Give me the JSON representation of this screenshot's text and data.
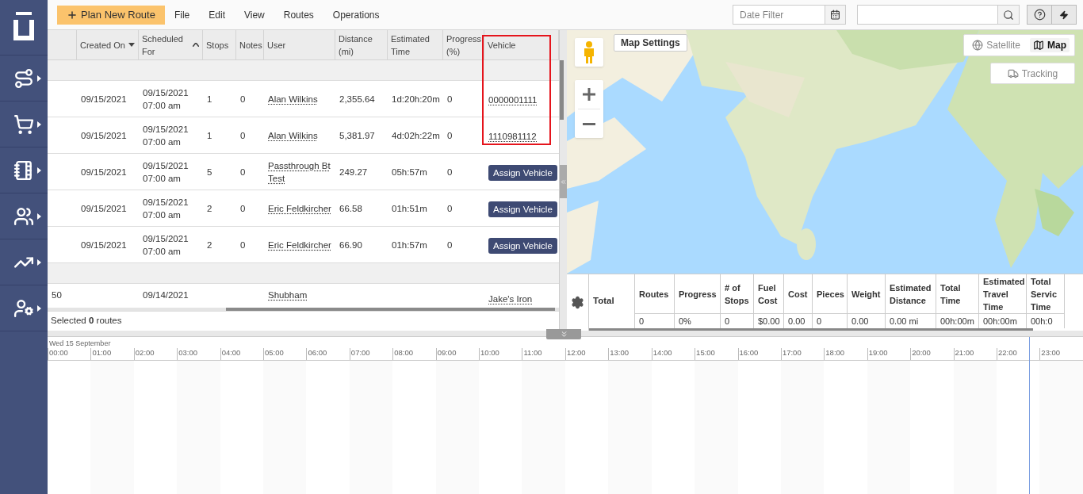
{
  "toolbar": {
    "primary_button": "Plan New Route",
    "menus": [
      "File",
      "Edit",
      "View",
      "Routes",
      "Operations"
    ],
    "date_filter": {
      "placeholder": "Date Filter"
    }
  },
  "routes_table": {
    "columns": [
      {
        "label": "Created On",
        "sorted": true,
        "descending": true
      },
      {
        "label": "Scheduled For",
        "sorted": true,
        "descending": false
      },
      {
        "label": "Stops",
        "sorted": false
      },
      {
        "label": "Notes",
        "sorted": false
      },
      {
        "label": "User",
        "sorted": false
      },
      {
        "label": "Distance (mi)",
        "sorted": false
      },
      {
        "label": "Estimated Time",
        "sorted": false
      },
      {
        "label": "Progress (%)",
        "sorted": false
      },
      {
        "label": "Vehicle",
        "sorted": false
      }
    ],
    "rows": [
      {
        "kind": "group"
      },
      {
        "kind": "route",
        "created": "09/15/2021",
        "scheduled_date": "09/15/2021",
        "scheduled_time": "07:00 am",
        "stops": "1",
        "notes": "0",
        "user": "Alan Wilkins",
        "distance": "2,355.64",
        "est_time": "1d:20h:20m",
        "progress": "0",
        "vehicle": {
          "kind": "link",
          "label": "0000001111"
        }
      },
      {
        "kind": "route",
        "created": "09/15/2021",
        "scheduled_date": "09/15/2021",
        "scheduled_time": "07:00 am",
        "stops": "1",
        "notes": "0",
        "user": "Alan Wilkins",
        "distance": "5,381.97",
        "est_time": "4d:02h:22m",
        "progress": "0",
        "vehicle": {
          "kind": "link",
          "label": "1110981112"
        }
      },
      {
        "kind": "route",
        "created": "09/15/2021",
        "scheduled_date": "09/15/2021",
        "scheduled_time": "07:00 am",
        "stops": "5",
        "notes": "0",
        "user": "Passthrough Bt Test",
        "distance": "249.27",
        "est_time": "05h:57m",
        "progress": "0",
        "vehicle": {
          "kind": "button",
          "label": "Assign Vehicle"
        }
      },
      {
        "kind": "route",
        "created": "09/15/2021",
        "scheduled_date": "09/15/2021",
        "scheduled_time": "07:00 am",
        "stops": "2",
        "notes": "0",
        "user": "Eric Feldkircher",
        "distance": "66.58",
        "est_time": "01h:51m",
        "progress": "0",
        "vehicle": {
          "kind": "button",
          "label": "Assign Vehicle"
        }
      },
      {
        "kind": "route",
        "created": "09/15/2021",
        "scheduled_date": "09/15/2021",
        "scheduled_time": "07:00 am",
        "stops": "2",
        "notes": "0",
        "user": "Eric Feldkircher",
        "distance": "66.90",
        "est_time": "01h:57m",
        "progress": "0",
        "vehicle": {
          "kind": "button",
          "label": "Assign Vehicle"
        }
      },
      {
        "kind": "group"
      },
      {
        "kind": "partial",
        "index": "50",
        "scheduled_date": "09/14/2021",
        "user": "Shubham",
        "vehicle": {
          "kind": "link",
          "label": "Jake's Iron"
        }
      }
    ],
    "footer": "Selected **0** routes"
  },
  "map": {
    "settings_button": "Map Settings",
    "map_types": [
      {
        "label": "Satellite",
        "selected": false
      },
      {
        "label": "Map",
        "selected": true
      }
    ],
    "tracking_button": "Tracking"
  },
  "summary": {
    "row_label": "Total",
    "columns": [
      {
        "label": "Routes",
        "value": "0"
      },
      {
        "label": "Progress",
        "value": "0%"
      },
      {
        "label": "# of Stops",
        "value": "0"
      },
      {
        "label": "Fuel Cost",
        "value": "$0.00"
      },
      {
        "label": "Cost",
        "value": "0.00"
      },
      {
        "label": "Pieces",
        "value": "0"
      },
      {
        "label": "Weight",
        "value": "0.00"
      },
      {
        "label": "Estimated Distance",
        "value": "0.00 mi"
      },
      {
        "label": "Total Time",
        "value": "00h:00m"
      },
      {
        "label": "Estimated Travel Time",
        "value": "00h:00m"
      },
      {
        "label": "Total Servic Time",
        "value": "00h:0"
      }
    ]
  },
  "timeline": {
    "date": "Wed 15 September",
    "hours": [
      "00:00",
      "01:00",
      "02:00",
      "03:00",
      "04:00",
      "05:00",
      "06:00",
      "07:00",
      "08:00",
      "09:00",
      "10:00",
      "11:00",
      "12:00",
      "13:00",
      "14:00",
      "15:00",
      "16:00",
      "17:00",
      "18:00",
      "19:00",
      "20:00",
      "21:00",
      "22:00",
      "23:00"
    ]
  }
}
